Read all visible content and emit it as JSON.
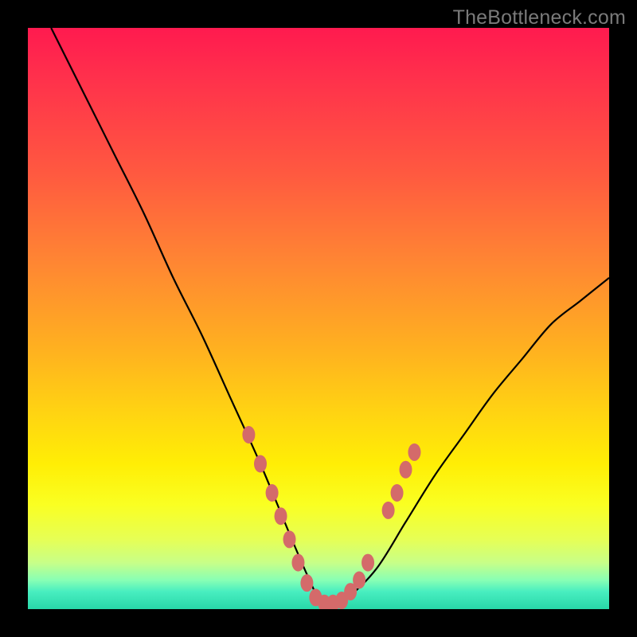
{
  "watermark": {
    "text": "TheBottleneck.com"
  },
  "chart_data": {
    "type": "line",
    "title": "",
    "xlabel": "",
    "ylabel": "",
    "xlim": [
      0,
      100
    ],
    "ylim": [
      0,
      100
    ],
    "series": [
      {
        "name": "curve",
        "x": [
          4,
          10,
          15,
          20,
          25,
          30,
          35,
          40,
          45,
          48,
          50,
          52,
          55,
          60,
          65,
          70,
          75,
          80,
          85,
          90,
          95,
          100
        ],
        "y": [
          100,
          88,
          78,
          68,
          57,
          47,
          36,
          25,
          13,
          6,
          2,
          1,
          2,
          7,
          15,
          23,
          30,
          37,
          43,
          49,
          53,
          57
        ]
      }
    ],
    "markers": [
      {
        "x": 38,
        "y": 30
      },
      {
        "x": 40,
        "y": 25
      },
      {
        "x": 42,
        "y": 20
      },
      {
        "x": 43.5,
        "y": 16
      },
      {
        "x": 45,
        "y": 12
      },
      {
        "x": 46.5,
        "y": 8
      },
      {
        "x": 48,
        "y": 4.5
      },
      {
        "x": 49.5,
        "y": 2
      },
      {
        "x": 51,
        "y": 1
      },
      {
        "x": 52.5,
        "y": 1
      },
      {
        "x": 54,
        "y": 1.5
      },
      {
        "x": 55.5,
        "y": 3
      },
      {
        "x": 57,
        "y": 5
      },
      {
        "x": 58.5,
        "y": 8
      },
      {
        "x": 62,
        "y": 17
      },
      {
        "x": 63.5,
        "y": 20
      },
      {
        "x": 65,
        "y": 24
      },
      {
        "x": 66.5,
        "y": 27
      }
    ],
    "marker_color": "#d46a6a",
    "line_color": "#000000"
  }
}
